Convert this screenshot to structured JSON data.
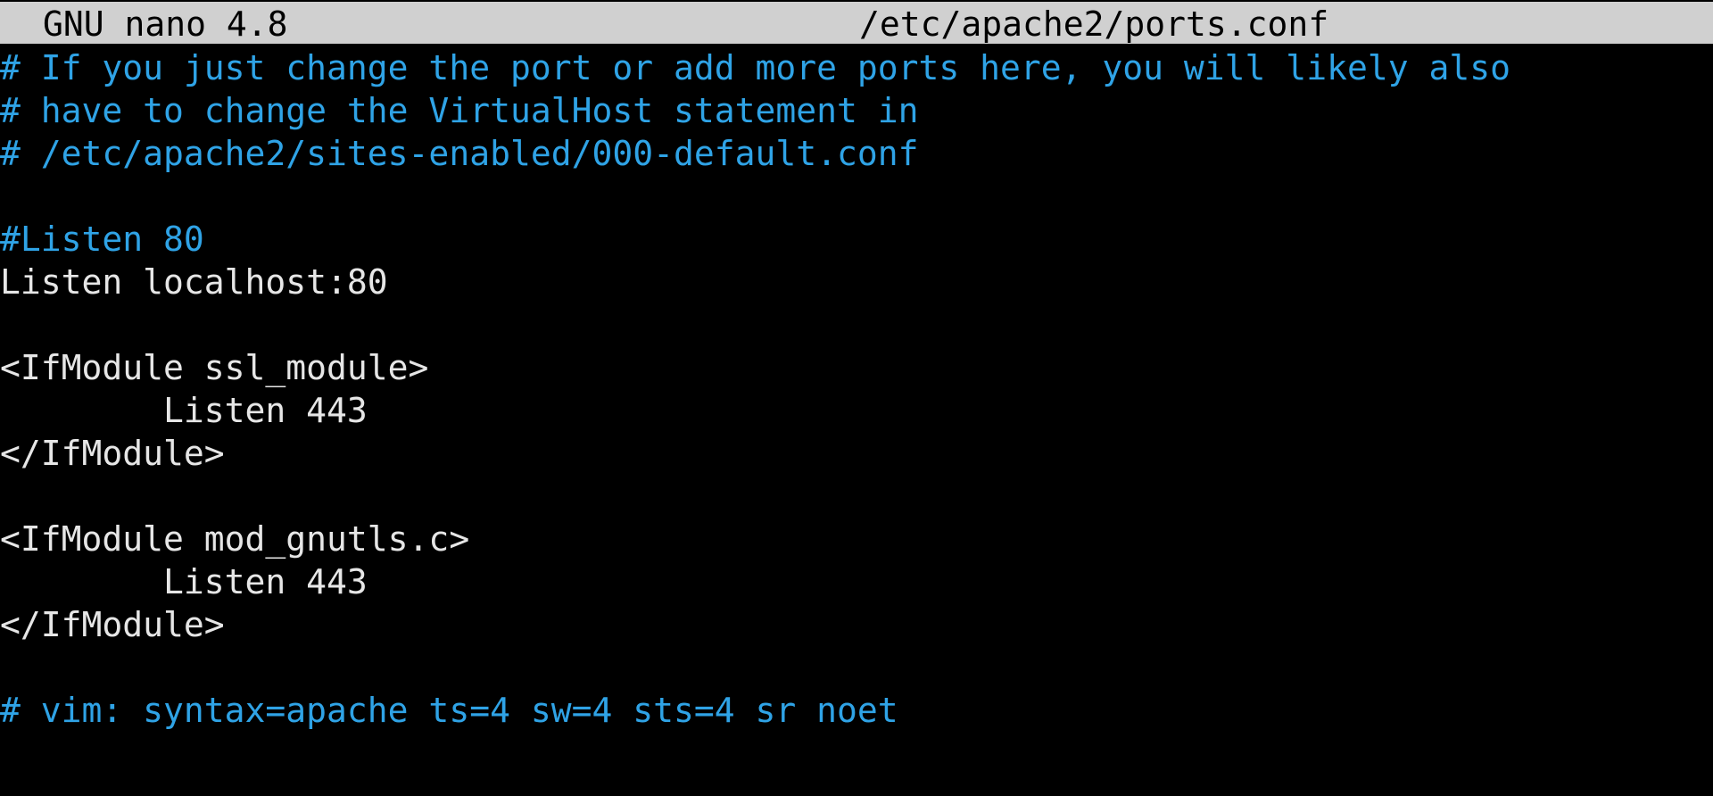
{
  "titlebar": {
    "app": "GNU nano 4.8",
    "file": "/etc/apache2/ports.conf"
  },
  "colors": {
    "titlebar_bg": "#d0d0d0",
    "background": "#000000",
    "comment": "#2fa3e6",
    "text": "#e6e6e6"
  },
  "editor": {
    "lines": [
      {
        "text": "# If you just change the port or add more ports here, you will likely also",
        "kind": "comment"
      },
      {
        "text": "# have to change the VirtualHost statement in",
        "kind": "comment"
      },
      {
        "text": "# /etc/apache2/sites-enabled/000-default.conf",
        "kind": "comment"
      },
      {
        "text": "",
        "kind": "empty"
      },
      {
        "text": "#Listen 80",
        "kind": "comment"
      },
      {
        "text": "Listen localhost:80",
        "kind": "plain"
      },
      {
        "text": "",
        "kind": "empty"
      },
      {
        "text": "<IfModule ssl_module>",
        "kind": "plain"
      },
      {
        "text": "        Listen 443",
        "kind": "plain"
      },
      {
        "text": "</IfModule>",
        "kind": "plain"
      },
      {
        "text": "",
        "kind": "empty"
      },
      {
        "text": "<IfModule mod_gnutls.c>",
        "kind": "plain"
      },
      {
        "text": "        Listen 443",
        "kind": "plain"
      },
      {
        "text": "</IfModule>",
        "kind": "plain"
      },
      {
        "text": "",
        "kind": "empty"
      },
      {
        "text": "# vim: syntax=apache ts=4 sw=4 sts=4 sr noet",
        "kind": "comment"
      }
    ]
  }
}
